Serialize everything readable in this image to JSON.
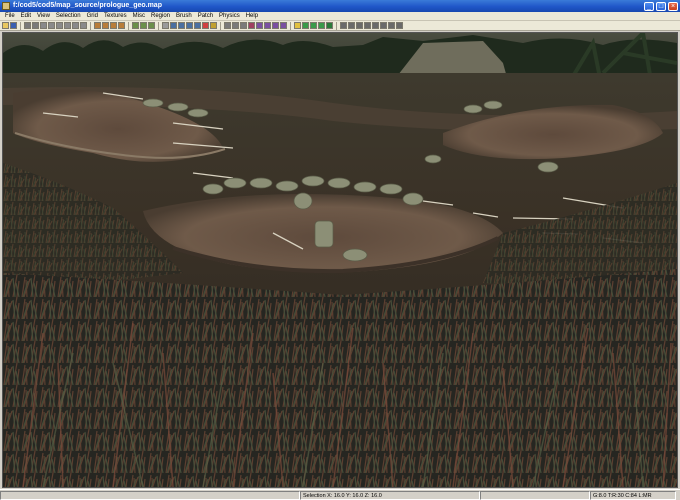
{
  "window": {
    "title": "f:/cod5/cod5/map_source/prologue_geo.map",
    "minimize_glyph": "_",
    "maximize_glyph": "□",
    "close_glyph": "×"
  },
  "menu": {
    "items": [
      "File",
      "Edit",
      "View",
      "Selection",
      "Grid",
      "Textures",
      "Misc",
      "Region",
      "Brush",
      "Patch",
      "Physics",
      "Help"
    ]
  },
  "toolbar": {
    "buttons": [
      {
        "icon": "open-icon",
        "color": "#e8c860"
      },
      {
        "icon": "save-icon",
        "color": "#3a5fb0"
      },
      {
        "sep": true
      },
      {
        "icon": "undo-icon",
        "color": "#7a7a7a"
      },
      {
        "icon": "redo-icon",
        "color": "#7a7a7a"
      },
      {
        "icon": "flip-x-icon",
        "color": "#8a8a8a"
      },
      {
        "icon": "flip-y-icon",
        "color": "#8a8a8a"
      },
      {
        "icon": "flip-z-icon",
        "color": "#8a8a8a"
      },
      {
        "icon": "rotate-x-icon",
        "color": "#8a8a8a"
      },
      {
        "icon": "rotate-y-icon",
        "color": "#8a8a8a"
      },
      {
        "icon": "rotate-z-icon",
        "color": "#8a8a8a"
      },
      {
        "sep": true
      },
      {
        "icon": "select-complete-icon",
        "color": "#b87d3a"
      },
      {
        "icon": "select-inside-icon",
        "color": "#b87d3a"
      },
      {
        "icon": "select-touching-icon",
        "color": "#b87d3a"
      },
      {
        "icon": "select-partial-icon",
        "color": "#b87d3a"
      },
      {
        "sep": true
      },
      {
        "icon": "csg-subtract-icon",
        "color": "#6b8f4a"
      },
      {
        "icon": "csg-merge-icon",
        "color": "#6b8f4a"
      },
      {
        "icon": "hollow-icon",
        "color": "#6b8f4a"
      },
      {
        "sep": true
      },
      {
        "icon": "clipper-icon",
        "color": "#9a9a9a"
      },
      {
        "icon": "change-views-icon",
        "color": "#4a6fa0"
      },
      {
        "icon": "texture-view-icon",
        "color": "#4a6fa0"
      },
      {
        "icon": "cubic-clip-icon",
        "color": "#4a6fa0"
      },
      {
        "icon": "camera-icon",
        "color": "#4a6fa0"
      },
      {
        "icon": "entity-view-icon",
        "color": "#d04040"
      },
      {
        "icon": "free-rotation-icon",
        "color": "#c0a030"
      },
      {
        "sep": true
      },
      {
        "icon": "scale-icon",
        "color": "#7a7a7a"
      },
      {
        "icon": "drag-edge-icon",
        "color": "#7a7a7a"
      },
      {
        "icon": "drag-vertex-icon",
        "color": "#7a7a7a"
      },
      {
        "icon": "patch-bend-icon",
        "color": "#a04060"
      },
      {
        "icon": "patch-insert-icon",
        "color": "#7a50a0"
      },
      {
        "icon": "patch-delete-icon",
        "color": "#7a50a0"
      },
      {
        "icon": "patch-show-icon",
        "color": "#7a50a0"
      },
      {
        "icon": "patch-select-icon",
        "color": "#7a50a0"
      },
      {
        "sep": true
      },
      {
        "icon": "light-preview-icon",
        "color": "#e0c040"
      },
      {
        "icon": "filter-icon",
        "color": "#3a9a4a"
      },
      {
        "icon": "model-icon",
        "color": "#3a9a4a"
      },
      {
        "icon": "sun-icon",
        "color": "#3a9a4a"
      },
      {
        "icon": "tree-icon",
        "color": "#2a7a3a"
      },
      {
        "sep": true
      },
      {
        "icon": "weld-icon",
        "color": "#6a6a6a"
      },
      {
        "icon": "split-icon",
        "color": "#6a6a6a"
      },
      {
        "icon": "grid-icon",
        "color": "#6a6a6a"
      },
      {
        "icon": "brush-icon",
        "color": "#6a6a6a"
      },
      {
        "icon": "path-icon",
        "color": "#6a6a6a"
      },
      {
        "icon": "texture-lock-icon",
        "color": "#6a6a6a"
      },
      {
        "icon": "font-icon",
        "color": "#6a6a6a"
      },
      {
        "icon": "help-icon",
        "color": "#6a6a6a"
      }
    ]
  },
  "viewport": {
    "mode": "3D camera view",
    "colors": {
      "sky": "#3b3e33",
      "trees": "#1e2a1c",
      "dirt": "#6b5647",
      "grass_dark": "#2b3226",
      "sandbag": "#8c8f76"
    }
  },
  "status": {
    "left": "",
    "selection": "Selection X: 16.0 Y: 16.0 Z: 16.0",
    "grid": "G:8.0 T:R:30 C:84 L:MR"
  }
}
